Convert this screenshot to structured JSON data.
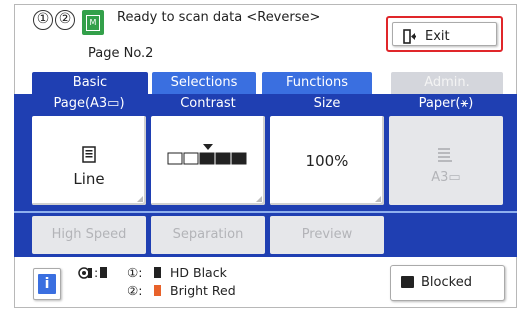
{
  "header": {
    "markers": [
      "①",
      "②"
    ],
    "status_icon_letter": "M",
    "status_text": "Ready to scan data <Reverse>",
    "page_no": "Page No.2",
    "exit_label": "Exit"
  },
  "tabs": [
    {
      "label": "Basic",
      "state": "active"
    },
    {
      "label": "Selections",
      "state": "normal"
    },
    {
      "label": "Functions",
      "state": "normal"
    },
    {
      "label": "Admin.",
      "state": "disabled"
    }
  ],
  "settings": {
    "page": {
      "label": "Page(A3▭)",
      "value": "Line",
      "icon": "document-icon"
    },
    "contrast": {
      "label": "Contrast",
      "level": 3,
      "levels": 5
    },
    "size": {
      "label": "Size",
      "value": "100%"
    },
    "paper": {
      "label": "Paper(⚹)",
      "value": "A3▭",
      "icon": "paper-stack-icon"
    }
  },
  "sub_buttons": [
    "High Speed",
    "Separation",
    "Preview"
  ],
  "footer": {
    "drum1_label": "①:",
    "drum1_ink": "HD Black",
    "drum2_label": "②:",
    "drum2_ink": "Bright Red",
    "blocked_label": "Blocked"
  },
  "colors": {
    "tab_active": "#1f3fb2",
    "tab_normal": "#3a6fe0",
    "exit_border": "#e0262a",
    "status_icon": "#33a04a",
    "ink_black": "#222222",
    "ink_red": "#e8622a"
  }
}
